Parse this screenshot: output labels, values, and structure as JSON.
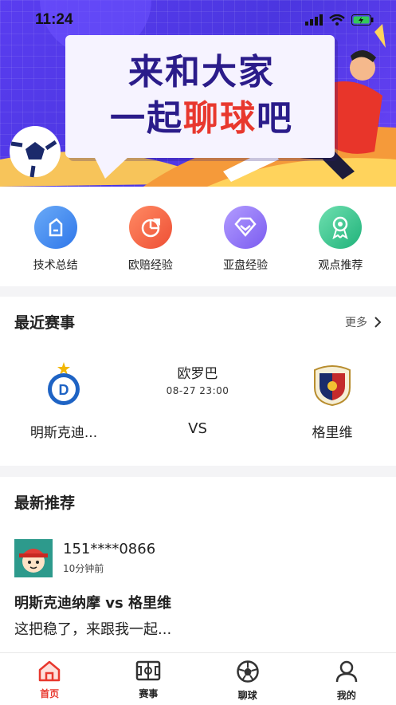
{
  "status": {
    "time": "11:24"
  },
  "banner": {
    "line1": "来和大家",
    "line2_a": "一起",
    "line2_b": "聊球",
    "line2_c": "吧"
  },
  "quick_menu": [
    {
      "label": "技术总结",
      "icon": "document-icon",
      "color": "#3b86f0"
    },
    {
      "label": "欧赔经验",
      "icon": "pie-chart-icon",
      "color": "#f2643f"
    },
    {
      "label": "亚盘经验",
      "icon": "diamond-icon",
      "color": "#8b6ff4"
    },
    {
      "label": "观点推荐",
      "icon": "award-icon",
      "color": "#34c48a"
    }
  ],
  "recent": {
    "title": "最近赛事",
    "more": "更多",
    "match": {
      "home": "明斯克迪...",
      "away": "格里维",
      "league": "欧罗巴",
      "datetime": "08-27 23:00",
      "vs": "VS"
    }
  },
  "latest": {
    "title": "最新推荐",
    "post": {
      "user": "151****0866",
      "ago": "10分钟前",
      "match_title": "明斯克迪纳摩 vs 格里维",
      "text": "这把稳了，来跟我一起..."
    }
  },
  "tabbar": [
    {
      "label": "首页",
      "icon": "home-icon",
      "active": true
    },
    {
      "label": "赛事",
      "icon": "pitch-icon",
      "active": false
    },
    {
      "label": "聊球",
      "icon": "football-icon",
      "active": false
    },
    {
      "label": "我的",
      "icon": "profile-icon",
      "active": false
    }
  ],
  "colors": {
    "accent": "#e8382e",
    "banner": "#5a3df0"
  }
}
